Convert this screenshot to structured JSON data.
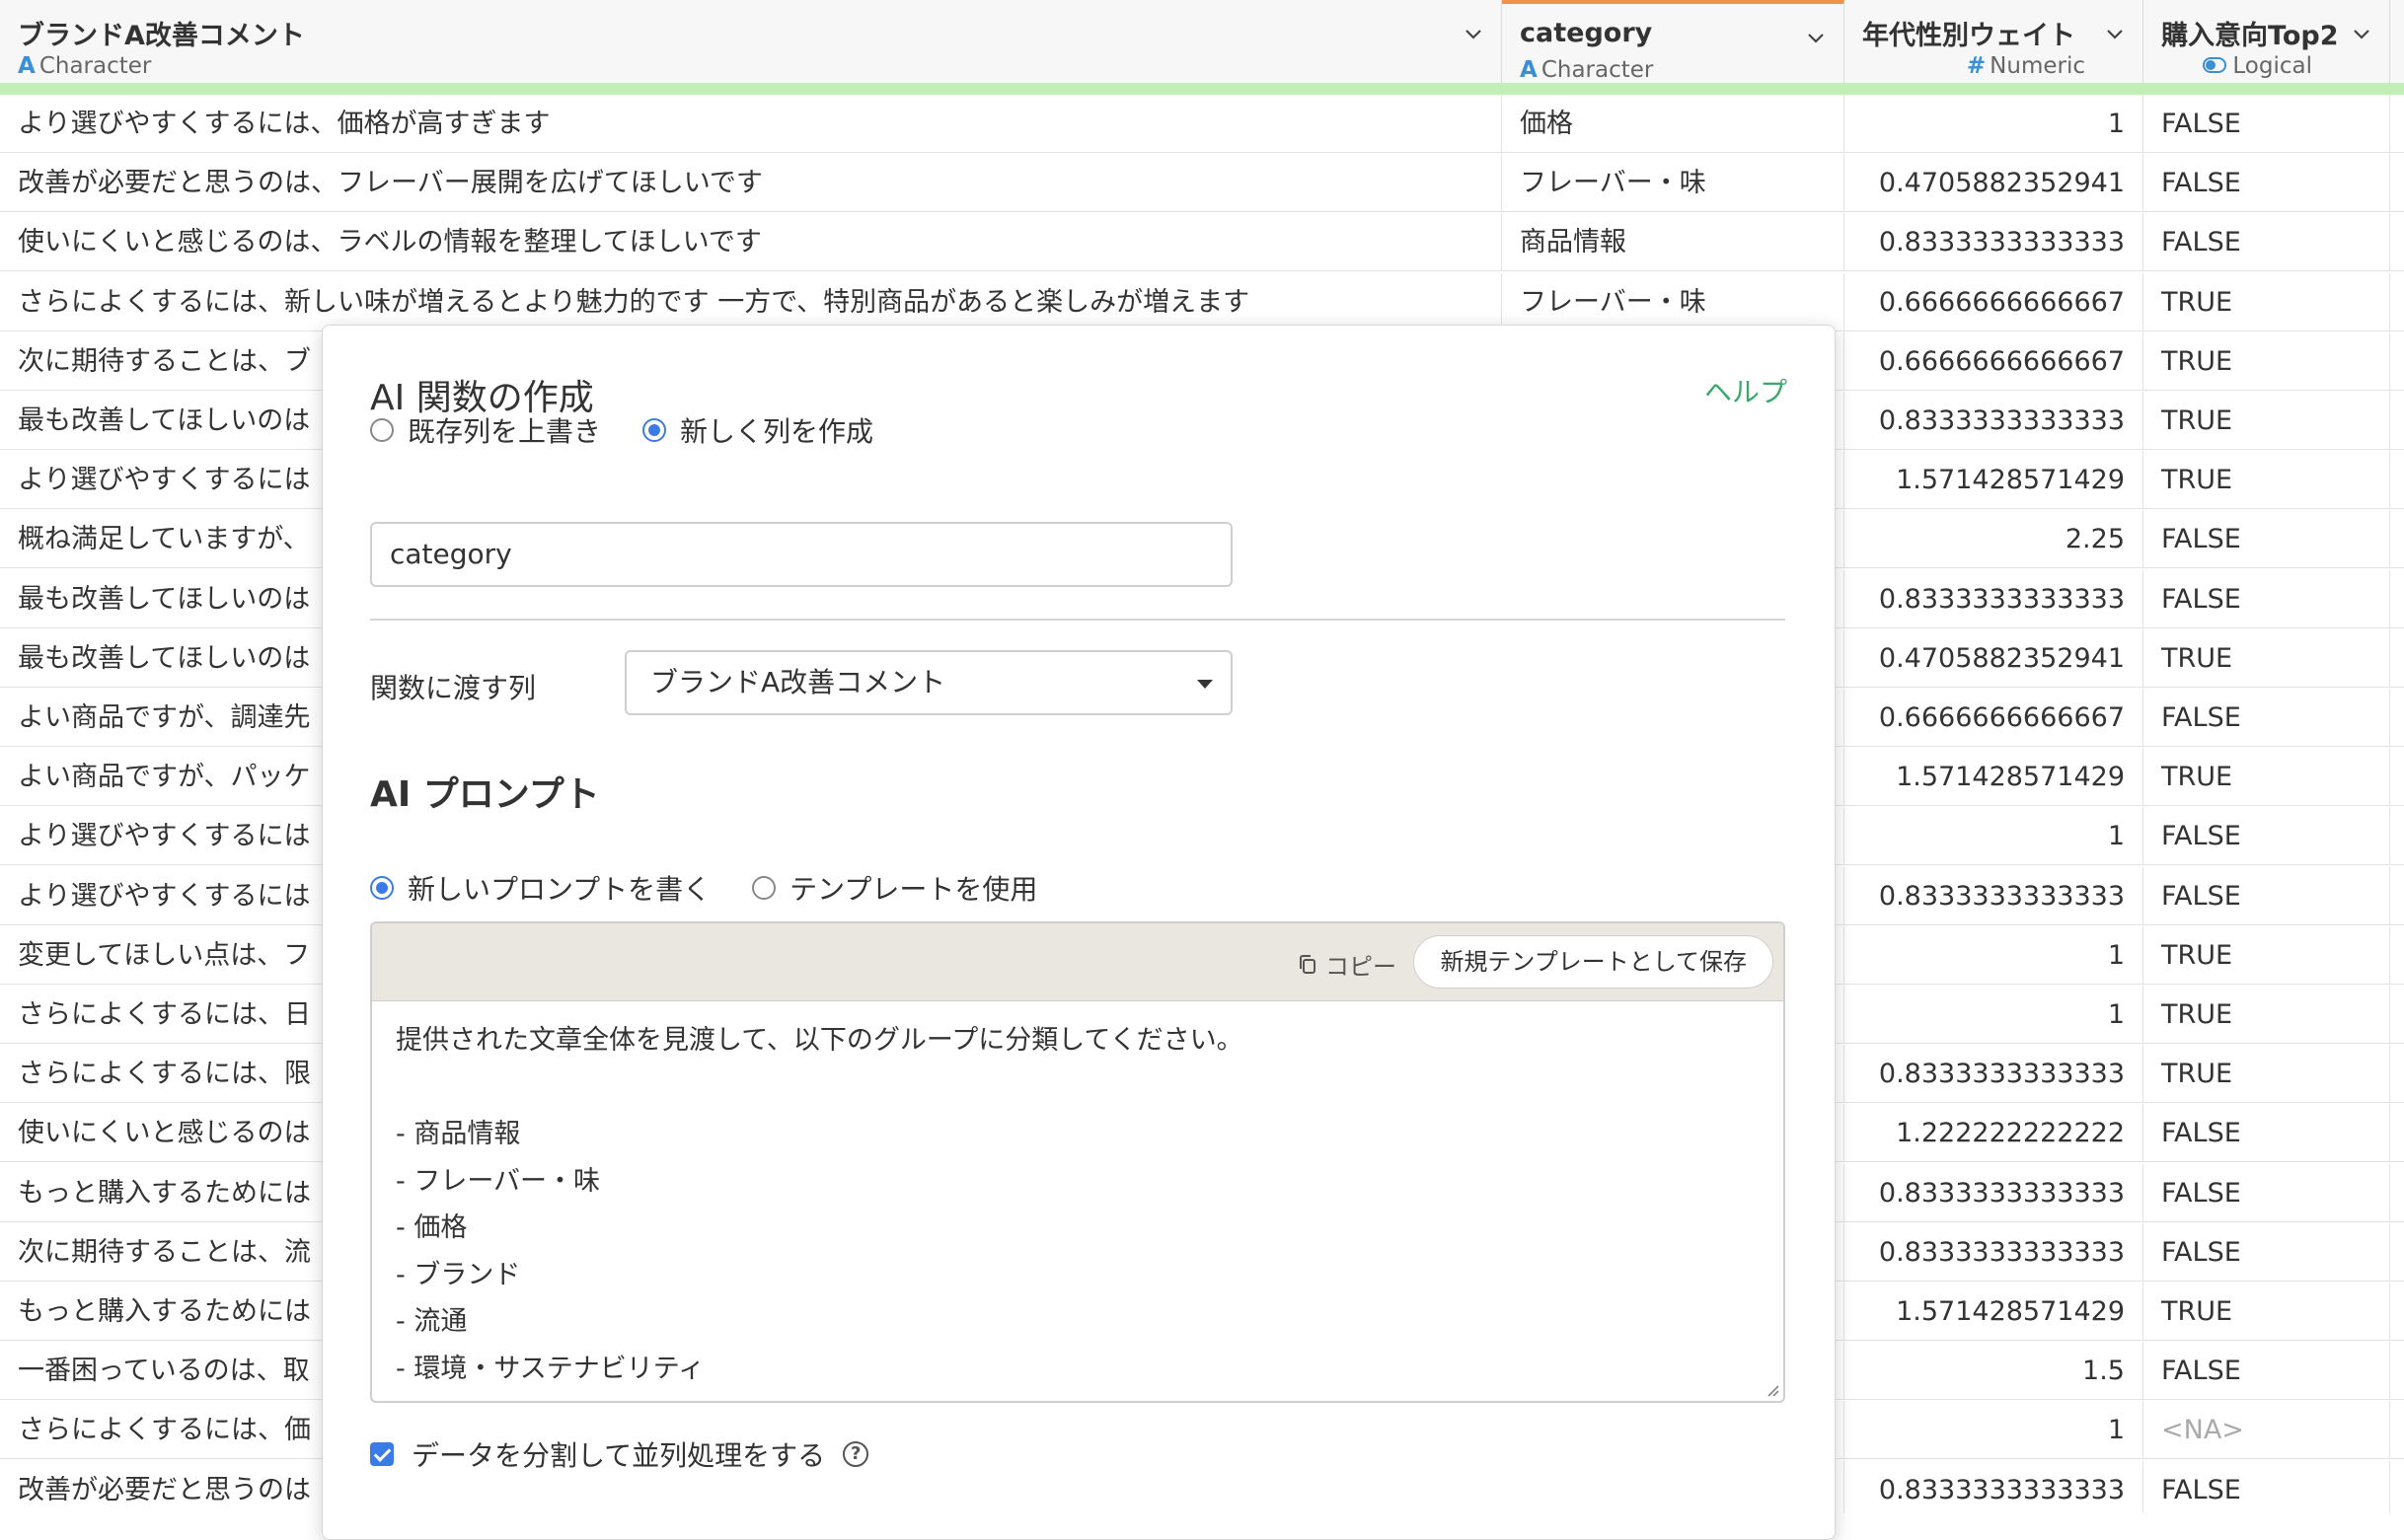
{
  "columns": [
    {
      "name": "ブランドA改善コメント",
      "type_icon": "A",
      "type": "Character"
    },
    {
      "name": "category",
      "type_icon": "A",
      "type": "Character"
    },
    {
      "name": "年代性別ウェイト",
      "type_icon": "#",
      "type": "Numeric"
    },
    {
      "name": "購入意向Top2",
      "type_icon": "toggle-icon",
      "type": "Logical"
    }
  ],
  "colors": {
    "accent": "#3b7be8",
    "help": "#3aa86a",
    "active_col": "#f0924a",
    "quality_bar": "#c2efb6",
    "type_icon": "#3b8fd6"
  },
  "rows": [
    [
      "より選びやすくするには、価格が高すぎます",
      "価格",
      "1",
      "FALSE"
    ],
    [
      "改善が必要だと思うのは、フレーバー展開を広げてほしいです",
      "フレーバー・味",
      "0.4705882352941",
      "FALSE"
    ],
    [
      "使いにくいと感じるのは、ラベルの情報を整理してほしいです",
      "商品情報",
      "0.8333333333333",
      "FALSE"
    ],
    [
      "さらによくするには、新しい味が増えるとより魅力的です 一方で、特別商品があると楽しみが増えます",
      "フレーバー・味",
      "0.6666666666667",
      "TRUE"
    ],
    [
      "次に期待することは、ブ",
      "",
      "0.6666666666667",
      "TRUE"
    ],
    [
      "最も改善してほしいのは",
      "",
      "0.8333333333333",
      "TRUE"
    ],
    [
      "より選びやすくするには",
      "",
      "1.571428571429",
      "TRUE"
    ],
    [
      "概ね満足していますが、",
      "",
      "2.25",
      "FALSE"
    ],
    [
      "最も改善してほしいのは",
      "",
      "0.8333333333333",
      "FALSE"
    ],
    [
      "最も改善してほしいのは",
      "",
      "0.4705882352941",
      "TRUE"
    ],
    [
      "よい商品ですが、調達先",
      "",
      "0.6666666666667",
      "FALSE"
    ],
    [
      "よい商品ですが、パッケ",
      "",
      "1.571428571429",
      "TRUE"
    ],
    [
      "より選びやすくするには",
      "",
      "1",
      "FALSE"
    ],
    [
      "より選びやすくするには",
      "",
      "0.8333333333333",
      "FALSE"
    ],
    [
      "変更してほしい点は、フ",
      "",
      "1",
      "TRUE"
    ],
    [
      "さらによくするには、日",
      "",
      "1",
      "TRUE"
    ],
    [
      "さらによくするには、限",
      "",
      "0.8333333333333",
      "TRUE"
    ],
    [
      "使いにくいと感じるのは",
      "",
      "1.222222222222",
      "FALSE"
    ],
    [
      "もっと購入するためには",
      "",
      "0.8333333333333",
      "FALSE"
    ],
    [
      "次に期待することは、流",
      "",
      "0.8333333333333",
      "FALSE"
    ],
    [
      "もっと購入するためには",
      "",
      "1.571428571429",
      "TRUE"
    ],
    [
      "一番困っているのは、取",
      "",
      "1.5",
      "FALSE"
    ],
    [
      "さらによくするには、価",
      "",
      "1",
      "<NA>"
    ],
    [
      "改善が必要だと思うのは",
      "",
      "0.8333333333333",
      "FALSE"
    ]
  ],
  "dialog": {
    "title": "AI 関数の作成",
    "help": "ヘルプ",
    "mode_overwrite": "既存列を上書き",
    "mode_new": "新しく列を作成",
    "new_column_name": "category",
    "pass_column_label": "関数に渡す列",
    "pass_column_value": "ブランドA改善コメント",
    "prompt_section": "AI プロンプト",
    "prompt_new": "新しいプロンプトを書く",
    "prompt_template": "テンプレートを使用",
    "copy": "コピー",
    "save_template": "新規テンプレートとして保存",
    "prompt_lines": [
      "提供された文章全体を見渡して、以下のグループに分類してください。",
      "",
      "- 商品情報",
      "- フレーバー・味",
      "- 価格",
      "- ブランド",
      "- 流通",
      "- 環境・サステナビリティ"
    ],
    "parallel_label": "データを分割して並列処理をする",
    "parallel_help": "?"
  }
}
